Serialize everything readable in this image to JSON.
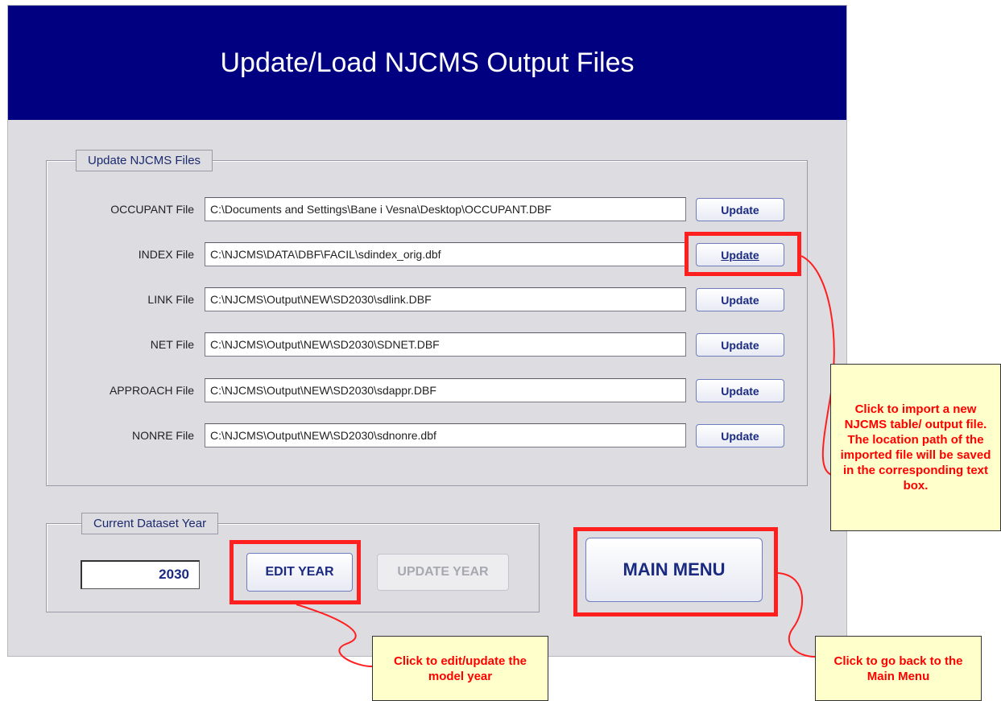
{
  "window": {
    "title": "Update/Load NJCMS Output Files"
  },
  "files_group": {
    "legend": "Update NJCMS Files",
    "rows": [
      {
        "label": "OCCUPANT File",
        "path": "C:\\Documents and Settings\\Bane i Vesna\\Desktop\\OCCUPANT.DBF",
        "button": "Update"
      },
      {
        "label": "INDEX File",
        "path": "C:\\NJCMS\\DATA\\DBF\\FACIL\\sdindex_orig.dbf",
        "button": "Update"
      },
      {
        "label": "LINK File",
        "path": "C:\\NJCMS\\Output\\NEW\\SD2030\\sdlink.DBF",
        "button": "Update"
      },
      {
        "label": "NET File",
        "path": "C:\\NJCMS\\Output\\NEW\\SD2030\\SDNET.DBF",
        "button": "Update"
      },
      {
        "label": "APPROACH File",
        "path": "C:\\NJCMS\\Output\\NEW\\SD2030\\sdappr.DBF",
        "button": "Update"
      },
      {
        "label": "NONRE File",
        "path": "C:\\NJCMS\\Output\\NEW\\SD2030\\sdnonre.dbf",
        "button": "Update"
      }
    ]
  },
  "year_group": {
    "legend": "Current Dataset Year",
    "year_value": "2030",
    "edit_button": "EDIT YEAR",
    "update_button": "UPDATE YEAR"
  },
  "main_menu_button": "MAIN MENU",
  "callouts": {
    "import": "Click to import a new NJCMS table/ output file. The location path of the imported file will be saved in the corresponding text box.",
    "edit_year": "Click to edit/update the model year",
    "main_menu": "Click to go back to the Main Menu"
  },
  "colors": {
    "title_bar": "#010080",
    "form_bg": "#dcdce1",
    "highlight": "#ff1f1f",
    "callout_bg": "#ffffcc",
    "callout_text": "#ff0000"
  }
}
